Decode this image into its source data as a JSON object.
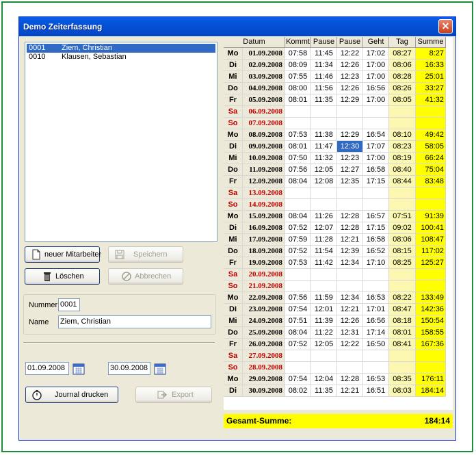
{
  "window": {
    "title": "Demo Zeiterfassung"
  },
  "employees": [
    {
      "number": "0001",
      "name": "Ziem, Christian",
      "selected": true
    },
    {
      "number": "0010",
      "name": "Klausen, Sebastian",
      "selected": false
    }
  ],
  "buttons": {
    "new_employee": "neuer Mitarbeiter",
    "save": "Speichern",
    "delete": "Löschen",
    "cancel": "Abbrechen",
    "print_journal": "Journal drucken",
    "export": "Export"
  },
  "form": {
    "number_label": "Nummer",
    "number_value": "0001",
    "name_label": "Name",
    "name_value": "Ziem, Christian"
  },
  "date_range": {
    "from": "01.09.2008",
    "to": "30.09.2008"
  },
  "table": {
    "headers": [
      "Datum",
      "Kommt",
      "Pause",
      "Pause",
      "Geht",
      "Tag",
      "Summe"
    ],
    "rows": [
      [
        "Mo",
        "01.09.2008",
        "07:58",
        "11:45",
        "12:22",
        "17:02",
        "08:27",
        "8:27"
      ],
      [
        "Di",
        "02.09.2008",
        "08:09",
        "11:34",
        "12:26",
        "17:00",
        "08:06",
        "16:33"
      ],
      [
        "Mi",
        "03.09.2008",
        "07:55",
        "11:46",
        "12:23",
        "17:00",
        "08:28",
        "25:01"
      ],
      [
        "Do",
        "04.09.2008",
        "08:00",
        "11:56",
        "12:26",
        "16:56",
        "08:26",
        "33:27"
      ],
      [
        "Fr",
        "05.09.2008",
        "08:01",
        "11:35",
        "12:29",
        "17:00",
        "08:05",
        "41:32"
      ],
      [
        "Sa",
        "06.09.2008",
        "",
        "",
        "",
        "",
        "",
        ""
      ],
      [
        "So",
        "07.09.2008",
        "",
        "",
        "",
        "",
        "",
        ""
      ],
      [
        "Mo",
        "08.09.2008",
        "07:53",
        "11:38",
        "12:29",
        "16:54",
        "08:10",
        "49:42"
      ],
      [
        "Di",
        "09.09.2008",
        "08:01",
        "11:47",
        "12:30",
        "17:07",
        "08:23",
        "58:05"
      ],
      [
        "Mi",
        "10.09.2008",
        "07:50",
        "11:32",
        "12:23",
        "17:00",
        "08:19",
        "66:24"
      ],
      [
        "Do",
        "11.09.2008",
        "07:56",
        "12:05",
        "12:27",
        "16:58",
        "08:40",
        "75:04"
      ],
      [
        "Fr",
        "12.09.2008",
        "08:04",
        "12:08",
        "12:35",
        "17:15",
        "08:44",
        "83:48"
      ],
      [
        "Sa",
        "13.09.2008",
        "",
        "",
        "",
        "",
        "",
        ""
      ],
      [
        "So",
        "14.09.2008",
        "",
        "",
        "",
        "",
        "",
        ""
      ],
      [
        "Mo",
        "15.09.2008",
        "08:04",
        "11:26",
        "12:28",
        "16:57",
        "07:51",
        "91:39"
      ],
      [
        "Di",
        "16.09.2008",
        "07:52",
        "12:07",
        "12:28",
        "17:15",
        "09:02",
        "100:41"
      ],
      [
        "Mi",
        "17.09.2008",
        "07:59",
        "11:28",
        "12:21",
        "16:58",
        "08:06",
        "108:47"
      ],
      [
        "Do",
        "18.09.2008",
        "07:52",
        "11:54",
        "12:39",
        "16:52",
        "08:15",
        "117:02"
      ],
      [
        "Fr",
        "19.09.2008",
        "07:53",
        "11:42",
        "12:34",
        "17:10",
        "08:25",
        "125:27"
      ],
      [
        "Sa",
        "20.09.2008",
        "",
        "",
        "",
        "",
        "",
        ""
      ],
      [
        "So",
        "21.09.2008",
        "",
        "",
        "",
        "",
        "",
        ""
      ],
      [
        "Mo",
        "22.09.2008",
        "07:56",
        "11:59",
        "12:34",
        "16:53",
        "08:22",
        "133:49"
      ],
      [
        "Di",
        "23.09.2008",
        "07:54",
        "12:01",
        "12:21",
        "17:01",
        "08:47",
        "142:36"
      ],
      [
        "Mi",
        "24.09.2008",
        "07:51",
        "11:39",
        "12:26",
        "16:56",
        "08:18",
        "150:54"
      ],
      [
        "Do",
        "25.09.2008",
        "08:04",
        "11:22",
        "12:31",
        "17:14",
        "08:01",
        "158:55"
      ],
      [
        "Fr",
        "26.09.2008",
        "07:52",
        "12:05",
        "12:22",
        "16:50",
        "08:41",
        "167:36"
      ],
      [
        "Sa",
        "27.09.2008",
        "",
        "",
        "",
        "",
        "",
        ""
      ],
      [
        "So",
        "28.09.2008",
        "",
        "",
        "",
        "",
        "",
        ""
      ],
      [
        "Mo",
        "29.09.2008",
        "07:54",
        "12:04",
        "12:28",
        "16:53",
        "08:35",
        "176:11"
      ],
      [
        "Di",
        "30.09.2008",
        "08:02",
        "11:35",
        "12:21",
        "16:51",
        "08:03",
        "184:14"
      ]
    ]
  },
  "total": {
    "label": "Gesamt-Summe:",
    "value": "184:14"
  },
  "colors": {
    "titlebar": "#0551d6",
    "sum_column": "#ffff00",
    "tag_column": "#fbf7b0",
    "weekend_text": "#c00000",
    "selection": "#316ac5"
  }
}
